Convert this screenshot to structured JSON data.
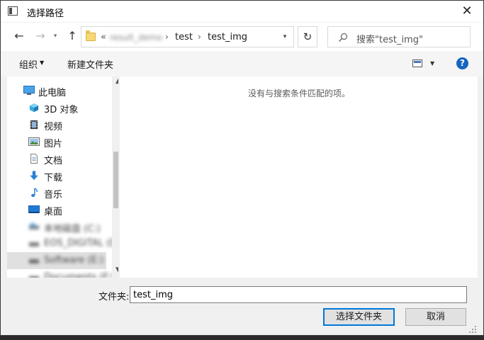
{
  "window": {
    "title": "选择路径",
    "close_glyph": "✕"
  },
  "nav": {
    "back_glyph": "←",
    "forward_glyph": "→",
    "recent_glyph": "▾",
    "up_glyph": "↑",
    "breadcrumb": {
      "overflow": "«",
      "blurred_segment": "result_demo",
      "segments": [
        "test",
        "test_img"
      ],
      "separator": "›"
    },
    "dropdown_glyph": "▾",
    "refresh_glyph": "↻",
    "search_placeholder": "搜索\"test_img\""
  },
  "toolbar": {
    "organize_label": "组织",
    "organize_caret": "▼",
    "new_folder_label": "新建文件夹",
    "view_caret": "▼",
    "help_glyph": "?"
  },
  "sidebar": {
    "items": [
      {
        "label": "此电脑",
        "icon": "computer-icon"
      },
      {
        "label": "3D 对象",
        "icon": "cube-3d-icon"
      },
      {
        "label": "视频",
        "icon": "video-icon"
      },
      {
        "label": "图片",
        "icon": "picture-icon"
      },
      {
        "label": "文档",
        "icon": "document-icon"
      },
      {
        "label": "下载",
        "icon": "download-icon"
      },
      {
        "label": "音乐",
        "icon": "music-icon"
      },
      {
        "label": "桌面",
        "icon": "desktop-icon"
      },
      {
        "label": "本地磁盘 (C:)",
        "icon": "drive-icon",
        "blurred": true
      },
      {
        "label": "EOS_DIGITAL (D:)",
        "icon": "drive-icon",
        "blurred": true
      },
      {
        "label": "Software (E:)",
        "icon": "drive-icon",
        "blurred": true
      },
      {
        "label": "Documents (F:)",
        "icon": "drive-icon",
        "blurred": true
      }
    ],
    "scroll_up_glyph": "▲",
    "scroll_down_glyph": "▼"
  },
  "content": {
    "empty_message": "没有与搜索条件匹配的项。"
  },
  "footer": {
    "folder_label": "文件夹:",
    "folder_value": "test_img",
    "select_button": "选择文件夹",
    "cancel_button": "取消"
  },
  "colors": {
    "accent": "#0078d7",
    "help_blue": "#1565c0",
    "folder_yellow": "#f8d775"
  }
}
